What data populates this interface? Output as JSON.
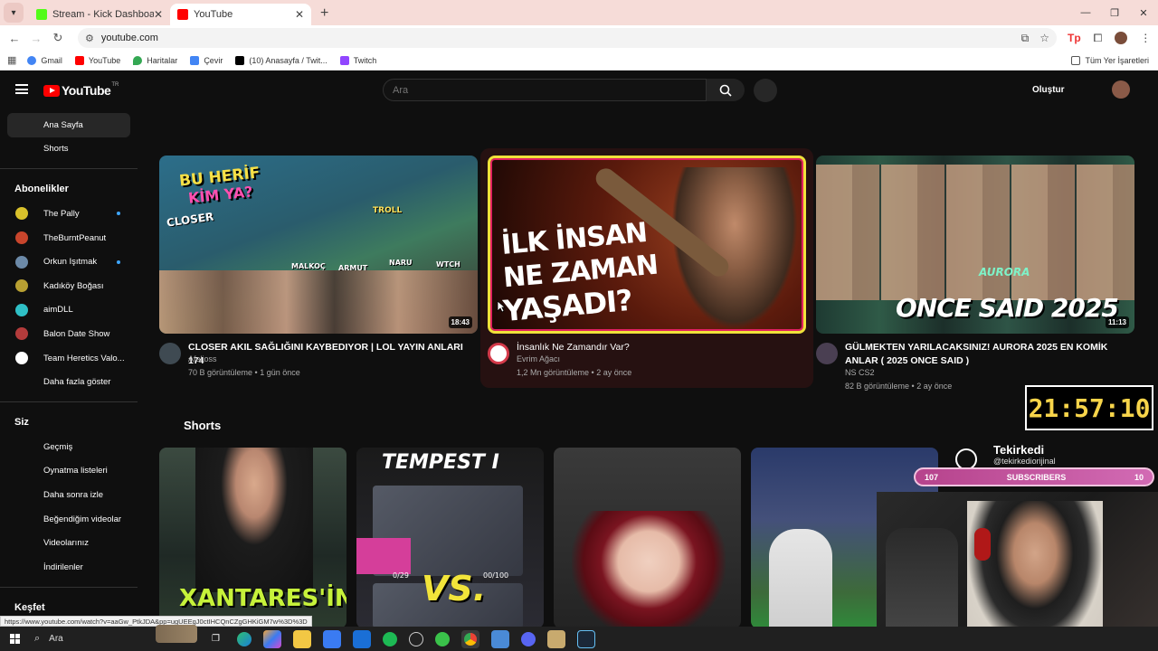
{
  "browser": {
    "tabs": [
      {
        "label": "Stream - Kick Dashboard",
        "active": false,
        "favicon_color": "#53fc18"
      },
      {
        "label": "YouTube",
        "active": true,
        "favicon_color": "#ff0000"
      }
    ],
    "address": "youtube.com",
    "bookmarks": [
      "Gmail",
      "YouTube",
      "Haritalar",
      "Çevir",
      "(10) Anasayfa / Twit...",
      "Twitch"
    ],
    "all_bookmarks": "Tüm Yer İşaretleri"
  },
  "yt": {
    "logo": "YouTube",
    "logo_sup": "TR",
    "search_placeholder": "Ara",
    "create_label": "Oluştur"
  },
  "sidebar": {
    "home": "Ana Sayfa",
    "shorts": "Shorts",
    "subs_heading": "Abonelikler",
    "subscriptions": [
      {
        "name": "The Pally",
        "color": "#d9c12b",
        "new": true
      },
      {
        "name": "TheBurntPeanut",
        "color": "#c8452c",
        "new": false
      },
      {
        "name": "Orkun Işıtmak",
        "color": "#6c8aa8",
        "new": true
      },
      {
        "name": "Kadıköy Boğası",
        "color": "#b8a032",
        "new": false
      },
      {
        "name": "aimDLL",
        "color": "#2fc0c6",
        "new": false
      },
      {
        "name": "Balon Date Show",
        "color": "#b33b3b",
        "new": false
      },
      {
        "name": "Team Heretics Valo...",
        "color": "#ffffff",
        "new": false
      }
    ],
    "show_more": "Daha fazla göster",
    "you_heading": "Siz",
    "you_items": [
      "Geçmiş",
      "Oynatma listeleri",
      "Daha sonra izle",
      "Beğendiğim videolar",
      "Videolarınız",
      "İndirilenler"
    ],
    "explore_heading": "Keşfet"
  },
  "videos": [
    {
      "title": "CLOSER AKIL SAĞLIĞINI KAYBEDIYOR | LOL YAYIN ANLARI 174",
      "channel": "Afelioss",
      "stats": "70 B görüntüleme • 1 gün önce",
      "duration": "18:43",
      "thumb_texts": [
        "BU HERİF",
        "KİM YA?",
        "CLOSER",
        "TROLL",
        "MALKOÇ",
        "ARMUT",
        "NARU",
        "WTCH"
      ]
    },
    {
      "title": "İnsanlık Ne Zamandır Var?",
      "channel": "Evrim Ağacı",
      "stats": "1,2 Mn görüntüleme • 2 ay önce",
      "duration": "",
      "thumb_texts": [
        "İLK İNSAN",
        "NE ZAMAN",
        "YAŞADI?"
      ]
    },
    {
      "title": "GÜLMEKTEN YARILACAKSINIZ! AURORA 2025 EN KOMİK ANLAR ( 2025 ONCE SAID )",
      "channel": "NS CS2",
      "stats": "82 B görüntüleme • 2 ay önce",
      "duration": "11:13",
      "thumb_texts": [
        "AURORA",
        "ONCE SAID 2025"
      ]
    }
  ],
  "shorts": {
    "heading": "Shorts",
    "items": [
      {
        "text": "XANTARES'İN"
      },
      {
        "text": "TEMPEST I",
        "sub": "VS.",
        "count1": "0/29",
        "count2": "00/100"
      },
      {
        "text": ""
      },
      {
        "text": ""
      }
    ]
  },
  "overlay": {
    "timer": "21:57:10",
    "subs_left": "107",
    "subs_label": "SUBSCRIBERS",
    "subs_right": "10",
    "tekir_name": "Tekirkedi",
    "tekir_handle": "@tekirkediorijinal"
  },
  "status_url": "https://www.youtube.com/watch?v=aaGw_PtkJDA&pp=ugUEEgJ0ctIHCQnCZgGHKiGM7w%3D%3D",
  "taskbar": {
    "search": "Ara"
  }
}
